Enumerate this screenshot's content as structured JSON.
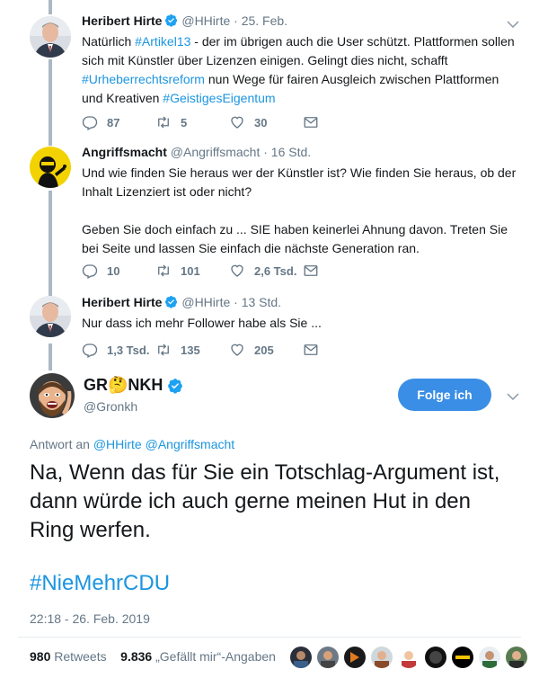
{
  "tweets": [
    {
      "name": "Heribert Hirte",
      "verified": true,
      "handle": "@HHirte",
      "dot": "·",
      "time": "25. Feb.",
      "text_parts": [
        "Natürlich ",
        "#Artikel13",
        " - der im übrigen auch die User schützt. Plattformen sollen sich mit Künstler über Lizenzen einigen. Gelingt dies nicht, schafft ",
        "#Urheberrechtsreform",
        " nun Wege für fairen Ausgleich zwischen Plattformen und Kreativen ",
        "#GeistigesEigentum"
      ],
      "replies": "87",
      "retweets": "5",
      "likes": "30"
    },
    {
      "name": "Angriffsmacht",
      "handle": "@Angriffsmacht",
      "dot": "·",
      "time": "16 Std.",
      "text_p1": "Und wie finden Sie heraus wer der Künstler ist? Wie finden Sie heraus, ob der Inhalt Lizenziert ist oder nicht?",
      "text_p2": "Geben Sie doch einfach zu ... SIE haben keinerlei Ahnung davon. Treten Sie bei Seite und lassen Sie einfach die nächste Generation ran.",
      "replies": "10",
      "retweets": "101",
      "likes": "2,6 Tsd."
    },
    {
      "name": "Heribert Hirte",
      "verified": true,
      "handle": "@HHirte",
      "dot": "·",
      "time": "13 Std.",
      "text": "Nur dass ich mehr Follower habe als Sie ...",
      "replies": "1,3 Tsd.",
      "retweets": "135",
      "likes": "205"
    }
  ],
  "main": {
    "name_prefix": "GR",
    "name_emoji": "🤔",
    "name_suffix": "NKH",
    "handle": "@Gronkh",
    "follow_label": "Folge ich",
    "reply_prefix": "Antwort an",
    "reply_to_1": "@HHirte",
    "reply_to_2": "@Angriffsmacht",
    "text": "Na, Wenn das für Sie ein Totschlag-Argument ist, dann würde ich auch gerne meinen Hut in den Ring werfen.",
    "hashtag": "#NieMehrCDU",
    "timestamp": "22:18 - 26. Feb. 2019",
    "retweets_count": "980",
    "retweets_label": "Retweets",
    "likes_count": "9.836",
    "likes_label": "„Gefällt mir“-Angaben"
  },
  "colors": {
    "link": "#1b95e0",
    "muted": "#657786",
    "follow_button": "#3a8ee6",
    "thread_line": "#aab8c2"
  },
  "icons": [
    "reply-icon",
    "retweet-icon",
    "like-icon",
    "message-icon",
    "verified-badge-icon",
    "chevron-down-icon"
  ]
}
